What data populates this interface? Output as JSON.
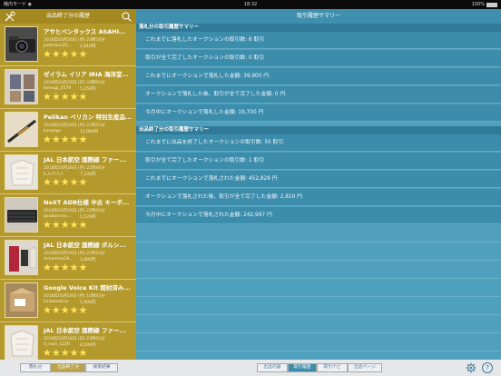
{
  "status_bar": {
    "carrier": "機内モード ◉",
    "time": "18:32",
    "battery": "100%"
  },
  "left_header": {
    "title": "出品終了分の履歴"
  },
  "items": [
    {
      "title": "アサヒペンタックス ASAHI...",
      "date": "2018年03月26日 (月) 23時10分",
      "seller": "poemasu20...",
      "price": "2,810円",
      "stars": "★★★★★",
      "thumb": "camera"
    },
    {
      "title": "ゼイラム イリア IRIA 海洋堂...",
      "date": "2018年03月26日 (月) 23時05分",
      "seller": "komugi_0579",
      "price": "5,250円",
      "stars": "★★★★★",
      "thumb": "cards"
    },
    {
      "title": "Pelikan ペリカン 特別生産品...",
      "date": "2018年03月26日 (月) 22時55分",
      "seller": "kunyago",
      "price": "11,000円",
      "stars": "★★★★★",
      "thumb": "pen"
    },
    {
      "title": "JAL 日本航空 国際線 ファー...",
      "date": "2018年03月26日 (月) 22時46分",
      "seller": "y_u_h_t_s",
      "price": "7,230円",
      "stars": "★★★★★",
      "thumb": "cloth"
    },
    {
      "title": "NeXT ADB仕様 中古 キーボ...",
      "date": "2018年03月26日 (月) 22時40分",
      "seller": "ganbaroroo...",
      "price": "5,520円",
      "stars": "★★★★★",
      "thumb": "keyboard"
    },
    {
      "title": "JAL 日本航空 国際線 ポルシ...",
      "date": "2018年03月26日 (月) 22時23分",
      "seller": "minamina19...",
      "price": "3,900円",
      "stars": "★★★★★",
      "thumb": "kit"
    },
    {
      "title": "Google Voice Kit 開封済み...",
      "date": "2018年03月19日 (月) 10時43分",
      "seller": "kirakosekira",
      "price": "1,900円",
      "stars": "★★★★★",
      "thumb": "box"
    },
    {
      "title": "JAL 日本航空 国際線 ファー...",
      "date": "2018年03月18日 (日) 23時02分",
      "seller": "d_man_1229",
      "price": "4,500円",
      "stars": "★★★★★",
      "thumb": "cloth"
    }
  ],
  "left_footer": {
    "tabs": [
      "落札分",
      "出品終了分",
      "検索結果"
    ]
  },
  "right_header": {
    "title": "取引履歴サマリー"
  },
  "won_section": {
    "title": "落札分の取引履歴サマリー",
    "rows": [
      "これまでに落札したオークションの取引数: 6 取引",
      "取引が全て完了したオークションの取引数: 0 取引",
      "これまでにオークションで落札した金額: 39,900 円",
      "オークションで落札した後、取引が全て完了した金額: 0 円",
      "今月中にオークションで落札した金額: 19,700 円"
    ]
  },
  "sold_section": {
    "title": "出品終了分の取引履歴サマリー",
    "rows": [
      "これまでに出品を終了したオークションの取引数: 50 取引",
      "取引が全て完了したオークションの取引数: 1 取引",
      "これまでにオークションで落札された金額: 452,828 円",
      "オークションで落札された後、取引が全て完了した金額: 2,810 円",
      "今月中にオークションで落札された金額: 242,997 円"
    ]
  },
  "right_footer": {
    "tabs": [
      "出品内容",
      "取引履歴",
      "取引ナビ",
      "出品ページ"
    ]
  },
  "colors": {
    "gold": "#b49a2c",
    "gold_dark": "#a48920",
    "star": "#ffe15a",
    "teal": "#4fa0bc",
    "teal_row": "#3c8cac",
    "teal_section": "#2f7a99"
  }
}
